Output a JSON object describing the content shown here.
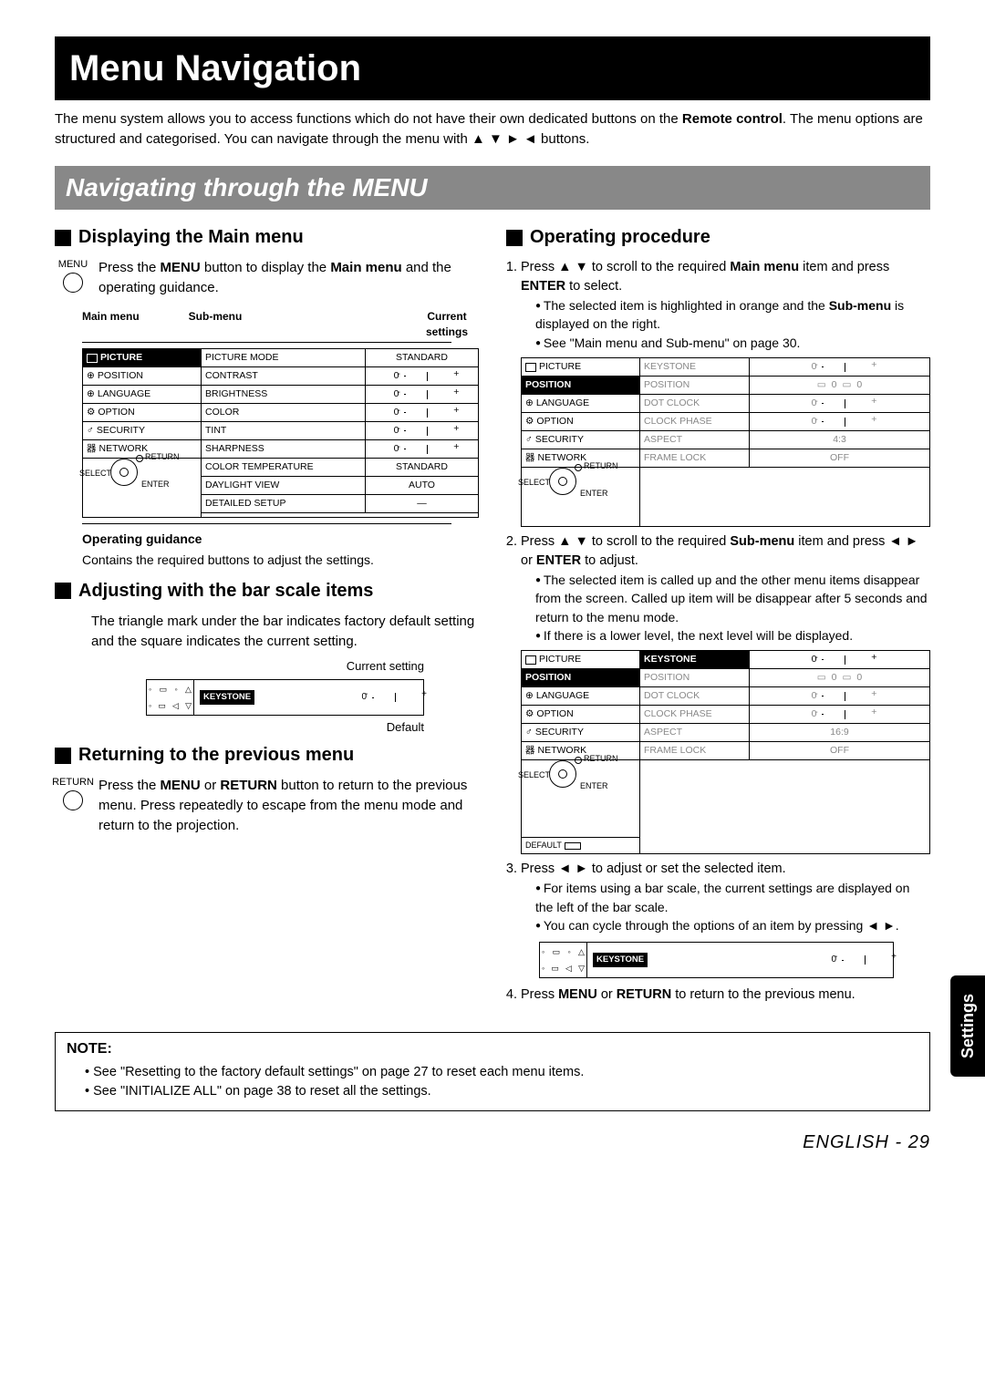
{
  "title": "Menu Navigation",
  "intro_1": "The menu system allows you to access functions which do not have their own dedicated buttons on the ",
  "intro_b1": "Remote control",
  "intro_2": ". The menu options are structured and categorised. You can navigate through the menu with ▲ ▼ ► ◄ buttons.",
  "section": "Navigating through the MENU",
  "left": {
    "h1": "Displaying the Main menu",
    "menu_label": "MENU",
    "h1_text_1": "Press the ",
    "h1_b1": "MENU",
    "h1_text_2": " button to display the ",
    "h1_b2": "Main menu",
    "h1_text_3": " and the operating guidance.",
    "lbl_main": "Main menu",
    "lbl_sub": "Sub-menu",
    "lbl_cur": "Current settings",
    "main_items": [
      "PICTURE",
      "POSITION",
      "LANGUAGE",
      "OPTION",
      "SECURITY",
      "NETWORK"
    ],
    "sub_items": [
      {
        "n": "PICTURE MODE",
        "v": "STANDARD",
        "bar": false
      },
      {
        "n": "CONTRAST",
        "v": "0",
        "bar": true
      },
      {
        "n": "BRIGHTNESS",
        "v": "0",
        "bar": true
      },
      {
        "n": "COLOR",
        "v": "0",
        "bar": true
      },
      {
        "n": "TINT",
        "v": "0",
        "bar": true
      },
      {
        "n": "SHARPNESS",
        "v": "0",
        "bar": true
      },
      {
        "n": "COLOR TEMPERATURE",
        "v": "STANDARD",
        "bar": false
      },
      {
        "n": "DAYLIGHT VIEW",
        "v": "AUTO",
        "bar": false
      },
      {
        "n": "DETAILED SETUP",
        "v": "—",
        "bar": false
      }
    ],
    "nav_return": "RETURN",
    "nav_select": "SELECT",
    "nav_enter": "ENTER",
    "opguide_h": "Operating guidance",
    "opguide_t": "Contains the required buttons to adjust the settings.",
    "h2": "Adjusting with the bar scale items",
    "h2_text": "The triangle mark under the bar indicates factory default setting and the square indicates the current setting.",
    "curset": "Current setting",
    "keystone": "KEYSTONE",
    "kval": "0",
    "default": "Default",
    "h3": "Returning to the previous menu",
    "return_label": "RETURN",
    "h3_text_1": "Press the ",
    "h3_b1": "MENU",
    "h3_text_2": " or ",
    "h3_b2": "RETURN",
    "h3_text_3": " button to return to the previous menu. Press repeatedly to escape from the menu mode and return to the projection."
  },
  "right": {
    "h1": "Operating procedure",
    "step1_a": "Press ▲ ▼ to scroll to the required ",
    "step1_b": "Main menu",
    "step1_c": " item and press ",
    "step1_d": "ENTER",
    "step1_e": " to select.",
    "step1_n1": "The selected item is highlighted in orange and the ",
    "step1_n1b": "Sub-menu",
    "step1_n1c": " is displayed on the right.",
    "step1_n2": "See \"Main menu and Sub-menu\" on page 30.",
    "menu1_main": [
      "PICTURE",
      "POSITION",
      "LANGUAGE",
      "OPTION",
      "SECURITY",
      "NETWORK"
    ],
    "menu1_sub": [
      {
        "n": "KEYSTONE",
        "v": "0",
        "bar": true
      },
      {
        "n": "POSITION",
        "v": "0",
        "bar": true,
        "dual": true
      },
      {
        "n": "DOT CLOCK",
        "v": "0",
        "bar": true
      },
      {
        "n": "CLOCK PHASE",
        "v": "0",
        "bar": true
      },
      {
        "n": "ASPECT",
        "v": "4:3",
        "bar": false
      },
      {
        "n": "FRAME LOCK",
        "v": "OFF",
        "bar": false
      }
    ],
    "step2_a": "Press ▲ ▼ to scroll to the required ",
    "step2_b": "Sub-menu",
    "step2_c": " item and press ◄ ► or ",
    "step2_d": "ENTER",
    "step2_e": " to adjust.",
    "step2_n1": "The selected item is called up and the other menu items disappear from the screen. Called up item will be disappear after 5 seconds and return to the menu mode.",
    "step2_n2": "If there is a lower level, the next level will be displayed.",
    "menu2_sub": [
      {
        "n": "KEYSTONE",
        "v": "0",
        "bar": true,
        "sel": true
      },
      {
        "n": "POSITION",
        "v": "0",
        "bar": true,
        "dual": true
      },
      {
        "n": "DOT CLOCK",
        "v": "0",
        "bar": true
      },
      {
        "n": "CLOCK PHASE",
        "v": "0",
        "bar": true
      },
      {
        "n": "ASPECT",
        "v": "16:9",
        "bar": false
      },
      {
        "n": "FRAME LOCK",
        "v": "OFF",
        "bar": false
      }
    ],
    "default_label": "DEFAULT",
    "step3_a": "Press ◄ ► to adjust or set the selected item.",
    "step3_n1": "For items using a bar scale, the current settings are displayed on the left of the bar scale.",
    "step3_n2": "You can cycle through the options of an item by pressing ◄ ►.",
    "step4": "Press ",
    "step4_b1": "MENU",
    "step4_m": " or ",
    "step4_b2": "RETURN",
    "step4_e": " to return to the previous menu."
  },
  "note_h": "NOTE:",
  "note1": "See \"Resetting to the factory default settings\" on page 27 to reset each menu items.",
  "note2": "See \"INITIALIZE ALL\" on page 38 to reset all the settings.",
  "side": "Settings",
  "footer_lang": "ENGLISH",
  "footer_page": "- 29"
}
